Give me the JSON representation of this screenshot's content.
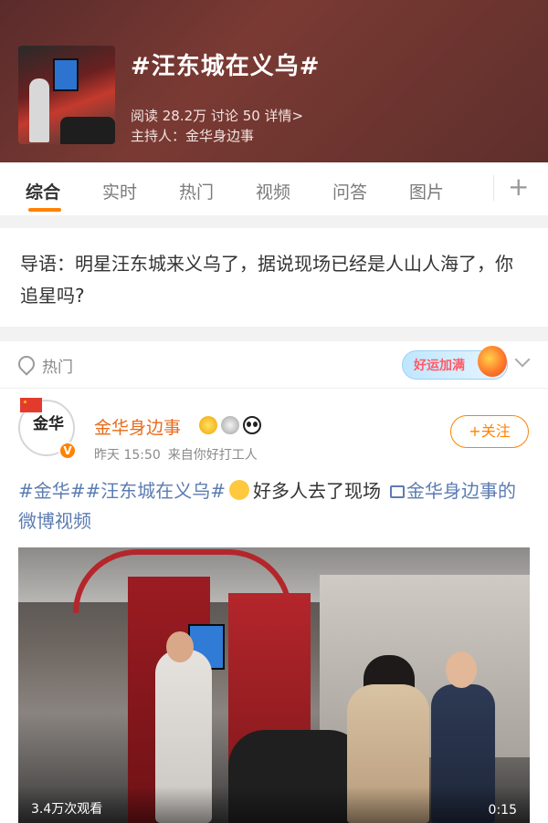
{
  "topic": {
    "title": "#汪东城在义乌#",
    "stats": "阅读 28.2万  讨论 50  详情>",
    "host": "主持人：金华身边事"
  },
  "tabs": [
    "综合",
    "实时",
    "热门",
    "视频",
    "问答",
    "图片"
  ],
  "tabs_active_index": 0,
  "tabs_add": "+",
  "intro": {
    "text": "导语：明星汪东城来义乌了，据说现场已经是人山人海了，你追星吗?"
  },
  "section": {
    "label": "热门",
    "banner": "好运加满"
  },
  "post": {
    "avatar_text": "金华",
    "user_name": "金华身边事",
    "time": "昨天 15:50",
    "source": "来自你好打工人",
    "follow_label": "+关注",
    "tag1": "#金华#",
    "tag2": "#汪东城在义乌#",
    "text": "好多人去了现场",
    "video_link": "金华身边事的微博视频",
    "video_views": "3.4万次观看",
    "video_duration": "0:15"
  },
  "colors": {
    "accent": "#ff8200",
    "link": "#5b7cb1",
    "user_name": "#e86b1a"
  }
}
